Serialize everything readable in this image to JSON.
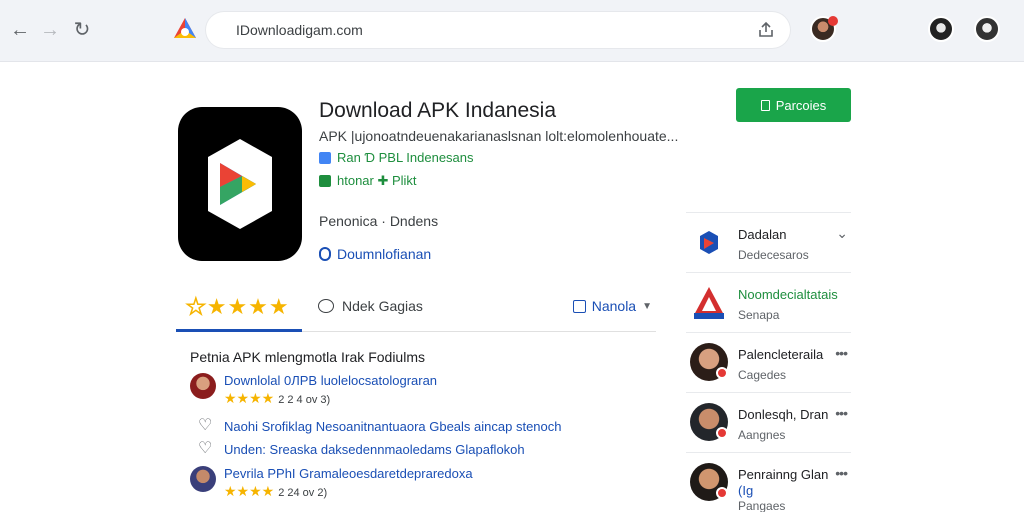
{
  "browser": {
    "url": "IDownloadigam.com",
    "back_icon": "back-arrow-icon",
    "forward_icon": "forward-arrow-icon",
    "reload_icon": "reload-icon"
  },
  "app": {
    "title": "Download APK Indanesia",
    "description": "APK |ujonoatndeuenakarianaslsnan lolt:elomolenhouate...",
    "tag1": "Ran Ɗ PBL Indenesans",
    "tag2": "htonar ✚ Plikt",
    "meta": "Penonica · Dndens",
    "download_link": "Doumnlofianan",
    "install_label": "Parcoies",
    "colors": {
      "install": "#1aa54a",
      "accent": "#1a4fb5",
      "star": "#f6b400"
    }
  },
  "tabs": {
    "reviews_label": "Ndek Gagias",
    "more_label": "Nanola"
  },
  "reviews": {
    "heading": "Petnia APK mlengmotla Irak Fodiulms",
    "items": [
      {
        "text": "Downlolal 0ЛPB luolelocsatolograran",
        "stars": "★★★★",
        "date": "2 2 4 ov 3)"
      },
      {
        "text": "Naohi Srofiklag Nesoanitnantuaora Gbeals aincap stenoch"
      },
      {
        "text": "Unden: Sreaska daksedennmaoledams Glapaflokoh"
      },
      {
        "text": "Pevrila PPhI Gramaleoesdaretdepraredoxa",
        "stars": "★★★★",
        "date": "2 24 ov 2)"
      }
    ]
  },
  "sidebar": {
    "items": [
      {
        "name": "Dadalan",
        "sub": "Dedecesaros"
      },
      {
        "name": "Noomdecialtatais",
        "sub": "Senapa"
      },
      {
        "name": "Palencleteraila",
        "sub": "Cagedes"
      },
      {
        "name": "Donlesqh, Dran",
        "sub": "Aangnes"
      },
      {
        "name": "Penrainng Glan",
        "name2": "(Ig",
        "sub": "Pangaes"
      }
    ]
  }
}
